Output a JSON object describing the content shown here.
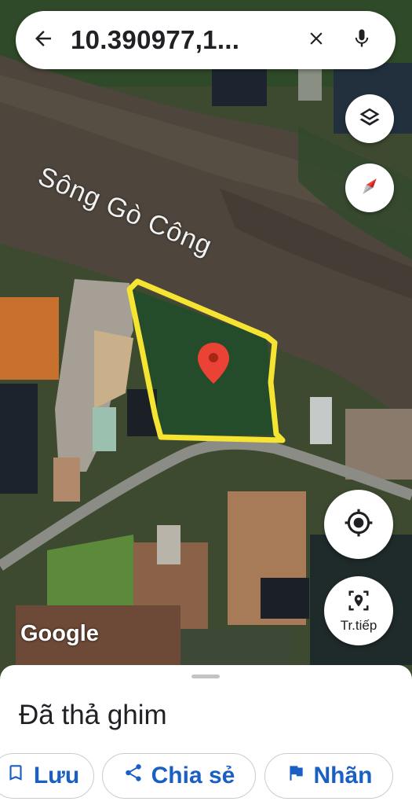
{
  "search": {
    "query": "10.390977,1...",
    "back_icon": "arrow-back-icon",
    "clear_icon": "close-icon",
    "mic_icon": "mic-icon"
  },
  "map": {
    "river_label": "Sông Gò Công",
    "attribution": "Google",
    "pin_color": "#ea4335",
    "boundary_color": "#f5e532"
  },
  "controls": {
    "layers_icon": "layers-icon",
    "compass_icon": "compass-icon",
    "location_icon": "my-location-icon",
    "navigate_label": "Tr.tiếp"
  },
  "sheet": {
    "title": "Đã thả ghim",
    "actions": [
      {
        "label": "Lưu",
        "icon": "bookmark-icon"
      },
      {
        "label": "Chia sẻ",
        "icon": "share-icon"
      },
      {
        "label": "Nhãn",
        "icon": "flag-icon"
      }
    ]
  }
}
